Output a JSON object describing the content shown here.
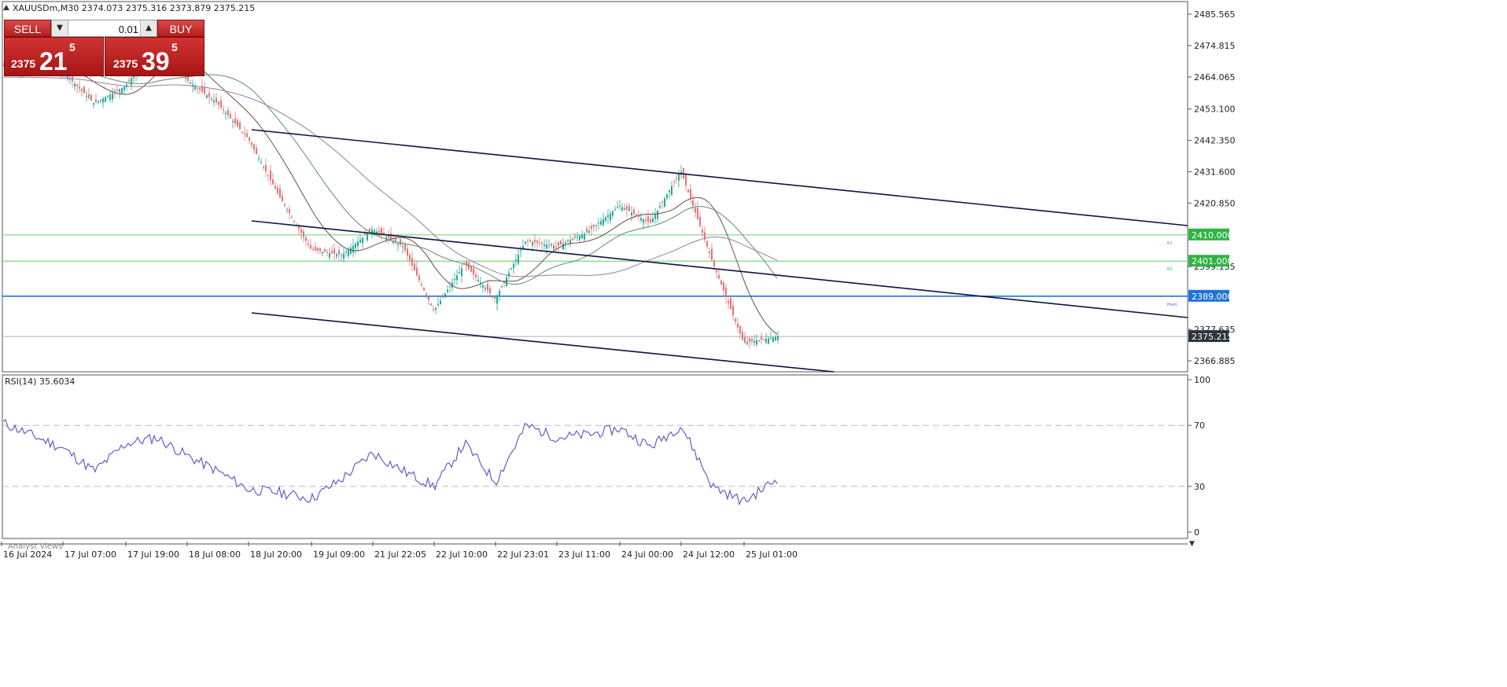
{
  "header": {
    "symbol_line": "XAUUSDm,M30  2374.073 2375.316 2373.879 2375.215",
    "indicator_label": "RSI(14) 35.6034",
    "bottom_tab": "Analyst Views"
  },
  "trade_panel": {
    "sell_label": "SELL",
    "buy_label": "BUY",
    "lot_value": "0.01",
    "sell_price_small": "2375",
    "sell_price_big": "21",
    "sell_price_sup": "5",
    "buy_price_small": "2375",
    "buy_price_big": "39",
    "buy_price_sup": "5"
  },
  "price_axis": {
    "ticks": [
      "2485.565",
      "2474.815",
      "2464.065",
      "2453.100",
      "2442.350",
      "2431.600",
      "2420.850",
      "2399.135",
      "2377.635",
      "2366.885"
    ],
    "tick_values": [
      2485.565,
      2474.815,
      2464.065,
      2453.1,
      2442.35,
      2431.6,
      2420.85,
      2399.135,
      2377.635,
      2366.885
    ]
  },
  "level_tags": [
    {
      "label": "2410.000",
      "value": 2410.0,
      "bg": "#2fb344",
      "line": "#7fd67f"
    },
    {
      "label": "2401.000",
      "value": 2401.0,
      "bg": "#2fb344",
      "line": "#7fd67f"
    },
    {
      "label": "2389.000",
      "value": 2389.0,
      "bg": "#1e73d6",
      "line": "#1e73d6"
    },
    {
      "label": "2375.215",
      "value": 2375.215,
      "bg": "#2d3440",
      "line": "#b8b8b8"
    }
  ],
  "level_markers": [
    "R1",
    "R2",
    "Pivot"
  ],
  "rsi_axis": {
    "ticks": [
      "100",
      "70",
      "30",
      "0"
    ],
    "levels": [
      70,
      30
    ]
  },
  "time_axis": [
    "16 Jul 2024",
    "17 Jul 07:00",
    "17 Jul 19:00",
    "18 Jul 08:00",
    "18 Jul 20:00",
    "19 Jul 09:00",
    "21 Jul 22:05",
    "22 Jul 10:00",
    "22 Jul 23:01",
    "23 Jul 11:00",
    "24 Jul 00:00",
    "24 Jul 12:00",
    "25 Jul 01:00"
  ],
  "colors": {
    "bull": "#26a69a",
    "bear": "#e57373",
    "ma_fast": "#6d4c41",
    "ma_mid": "#5a8f6a",
    "ma_slow": "#9a7aa8",
    "channel": "#0d1440",
    "rsi": "#6a5acd",
    "grid": "#c8c8c8"
  },
  "chart_data": {
    "type": "line",
    "title": "XAUUSDm,M30",
    "price_series": [
      {
        "t": "16 Jul 2024",
        "close": 2468
      },
      {
        "t": "17 Jul 07:00",
        "close": 2466
      },
      {
        "t": "17 Jul 13:00",
        "close": 2455
      },
      {
        "t": "17 Jul 19:00",
        "close": 2461
      },
      {
        "t": "18 Jul 02:00",
        "close": 2475
      },
      {
        "t": "18 Jul 08:00",
        "close": 2463
      },
      {
        "t": "18 Jul 14:00",
        "close": 2455
      },
      {
        "t": "18 Jul 20:00",
        "close": 2443
      },
      {
        "t": "19 Jul 03:00",
        "close": 2423
      },
      {
        "t": "19 Jul 09:00",
        "close": 2405
      },
      {
        "t": "19 Jul 15:00",
        "close": 2403
      },
      {
        "t": "21 Jul 22:05",
        "close": 2412
      },
      {
        "t": "22 Jul 04:00",
        "close": 2406
      },
      {
        "t": "22 Jul 10:00",
        "close": 2384
      },
      {
        "t": "22 Jul 16:00",
        "close": 2400
      },
      {
        "t": "22 Jul 23:01",
        "close": 2388
      },
      {
        "t": "23 Jul 05:00",
        "close": 2408
      },
      {
        "t": "23 Jul 11:00",
        "close": 2406
      },
      {
        "t": "23 Jul 17:00",
        "close": 2411
      },
      {
        "t": "24 Jul 00:00",
        "close": 2420
      },
      {
        "t": "24 Jul 06:00",
        "close": 2414
      },
      {
        "t": "24 Jul 12:00",
        "close": 2432
      },
      {
        "t": "24 Jul 18:00",
        "close": 2401
      },
      {
        "t": "25 Jul 01:00",
        "close": 2373
      },
      {
        "t": "25 Jul 04:00",
        "close": 2375.215
      }
    ],
    "rsi_series": [
      {
        "t": "16 Jul 2024",
        "value": 72
      },
      {
        "t": "17 Jul 07:00",
        "value": 55
      },
      {
        "t": "17 Jul 13:00",
        "value": 40
      },
      {
        "t": "17 Jul 19:00",
        "value": 58
      },
      {
        "t": "18 Jul 02:00",
        "value": 62
      },
      {
        "t": "18 Jul 08:00",
        "value": 50
      },
      {
        "t": "18 Jul 14:00",
        "value": 40
      },
      {
        "t": "18 Jul 20:00",
        "value": 28
      },
      {
        "t": "19 Jul 03:00",
        "value": 26
      },
      {
        "t": "19 Jul 09:00",
        "value": 22
      },
      {
        "t": "19 Jul 15:00",
        "value": 35
      },
      {
        "t": "21 Jul 22:05",
        "value": 52
      },
      {
        "t": "22 Jul 04:00",
        "value": 40
      },
      {
        "t": "22 Jul 10:00",
        "value": 30
      },
      {
        "t": "22 Jul 16:00",
        "value": 58
      },
      {
        "t": "22 Jul 23:01",
        "value": 33
      },
      {
        "t": "23 Jul 05:00",
        "value": 70
      },
      {
        "t": "23 Jul 11:00",
        "value": 62
      },
      {
        "t": "23 Jul 17:00",
        "value": 64
      },
      {
        "t": "24 Jul 00:00",
        "value": 68
      },
      {
        "t": "24 Jul 06:00",
        "value": 56
      },
      {
        "t": "24 Jul 12:00",
        "value": 70
      },
      {
        "t": "24 Jul 18:00",
        "value": 30
      },
      {
        "t": "25 Jul 01:00",
        "value": 20
      },
      {
        "t": "25 Jul 04:00",
        "value": 35.6034
      }
    ],
    "ylim": [
      2362.5,
      2491
    ],
    "rsi_ylim": [
      0,
      100
    ],
    "grid": false
  }
}
